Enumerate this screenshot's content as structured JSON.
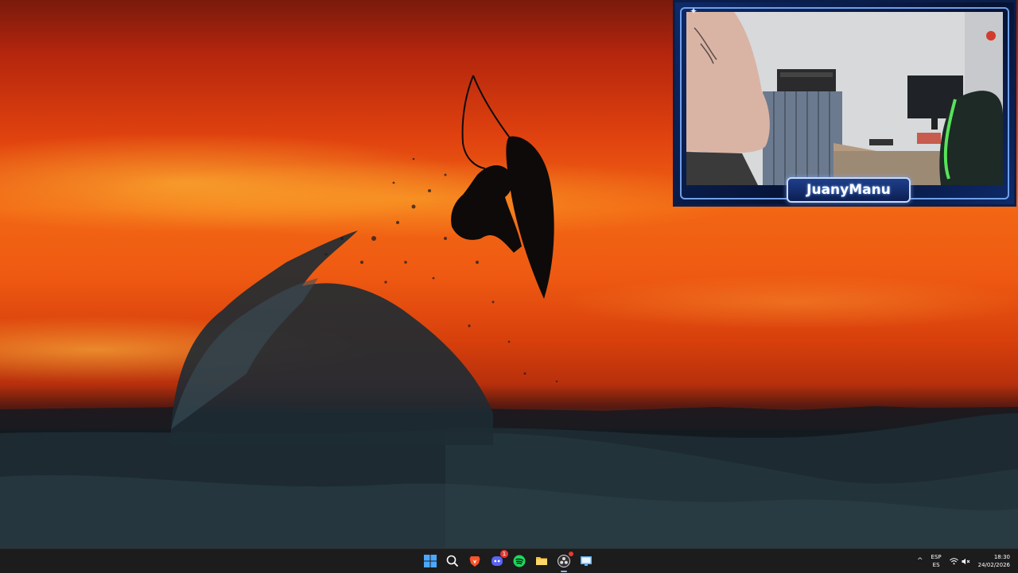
{
  "webcam": {
    "streamer_name": "JuanyManu"
  },
  "taskbar": {
    "apps": [
      {
        "name": "start",
        "icon": "windows-start-icon"
      },
      {
        "name": "search",
        "icon": "search-icon"
      },
      {
        "name": "brave",
        "icon": "brave-browser-icon"
      },
      {
        "name": "discord",
        "icon": "discord-icon",
        "badge": "1"
      },
      {
        "name": "spotify",
        "icon": "spotify-icon"
      },
      {
        "name": "file-explorer",
        "icon": "folder-icon"
      },
      {
        "name": "obs",
        "icon": "obs-icon",
        "active": true
      },
      {
        "name": "remote-desktop",
        "icon": "monitor-app-icon"
      }
    ],
    "tray": {
      "chevron": "^",
      "lang_top": "ESP",
      "lang_bottom": "ES",
      "time": "18:30",
      "date": "24/02/2026"
    }
  },
  "colors": {
    "taskbar_bg": "#1c1c1c",
    "webcam_frame": "#0d2a6a",
    "webcam_accent": "#6fa0e8"
  }
}
